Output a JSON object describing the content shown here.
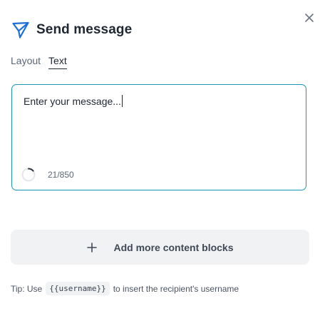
{
  "dialog": {
    "title": "Send message",
    "title_icon": "send-icon",
    "close_icon": "close-icon"
  },
  "tabs": [
    {
      "label": "Layout",
      "active": false
    },
    {
      "label": "Text",
      "active": true
    }
  ],
  "editor": {
    "value": "Enter your message...",
    "char_count": "21/850",
    "progress_fraction": 0.0247
  },
  "add_blocks": {
    "icon": "plus-icon",
    "label": "Add more content blocks"
  },
  "tip": {
    "prefix": "Tip: Use",
    "code": "{{username}}",
    "suffix": "to insert the recipient's username"
  },
  "colors": {
    "accent": "#1b97b3",
    "icon_blue": "#1e6fd9",
    "text": "#1f2733",
    "muted": "#5b6674",
    "button_bg": "#f1f2f4"
  }
}
